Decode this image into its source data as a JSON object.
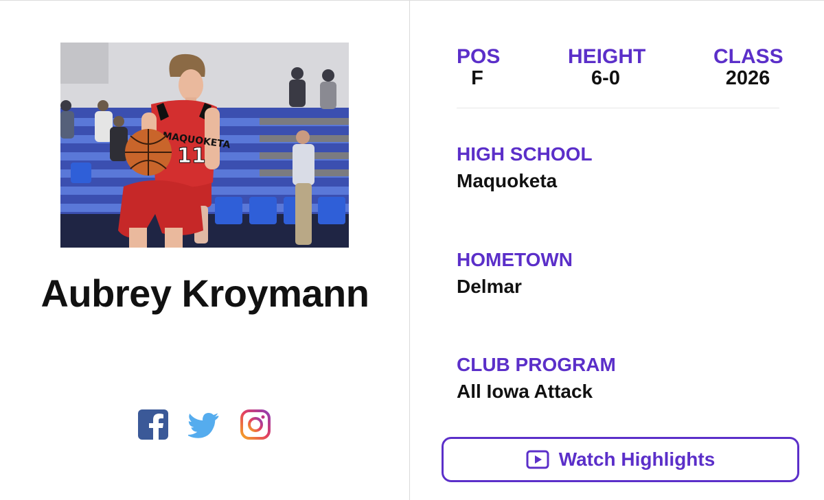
{
  "player": {
    "name": "Aubrey Kroymann",
    "jersey_text": "MAQUOKETA",
    "jersey_number": "11",
    "photo_alt": "player-photo"
  },
  "stats": {
    "pos_label": "POS",
    "pos_value": "F",
    "height_label": "HEIGHT",
    "height_value": "6-0",
    "class_label": "CLASS",
    "class_value": "2026"
  },
  "info": {
    "high_school_label": "HIGH SCHOOL",
    "high_school_value": "Maquoketa",
    "hometown_label": "HOMETOWN",
    "hometown_value": "Delmar",
    "club_label": "CLUB PROGRAM",
    "club_value": "All Iowa Attack"
  },
  "actions": {
    "watch_label": "Watch Highlights"
  },
  "social": [
    {
      "icon": "facebook-icon",
      "color": "#3b5998"
    },
    {
      "icon": "twitter-icon",
      "color": "#55acee"
    },
    {
      "icon": "instagram-icon",
      "color": "#c13584"
    }
  ],
  "colors": {
    "accent": "#5b2fc9",
    "text": "#111111"
  }
}
